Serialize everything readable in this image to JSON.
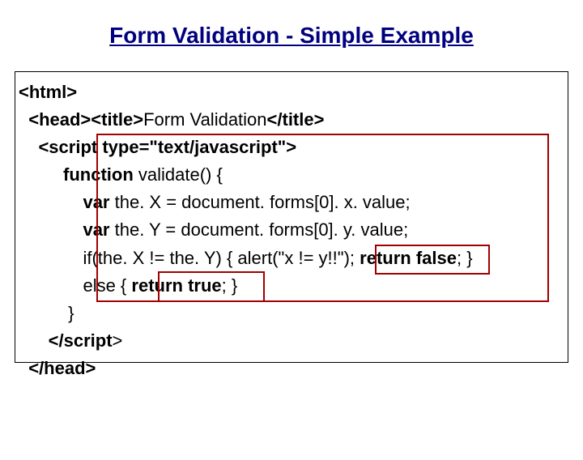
{
  "title": "Form Validation - Simple Example",
  "code": {
    "l1a": "<html>",
    "l2a": "  <head>",
    "l2b": "<title>",
    "l2c": "Form Validation",
    "l2d": "</title>",
    "l3a": "    <script ",
    "l3b": "type=\"text/javascript\">",
    "l4a": "         function ",
    "l4b": "validate() {",
    "l5a": "             var ",
    "l5b": "the. X = document. forms[0]. x. value;",
    "l6a": "             var ",
    "l6b": "the. Y = document. forms[0]. y. value;",
    "l7a": "             if(the. X != the. Y) { alert(\"x != y!!\"); ",
    "l7b": "return false",
    "l7c": "; }",
    "l8a": "             else { ",
    "l8b": "return true",
    "l8c": "; }",
    "l9": "          }",
    "l10": "      </script",
    "l10b": ">",
    "l11": "  </head>"
  }
}
